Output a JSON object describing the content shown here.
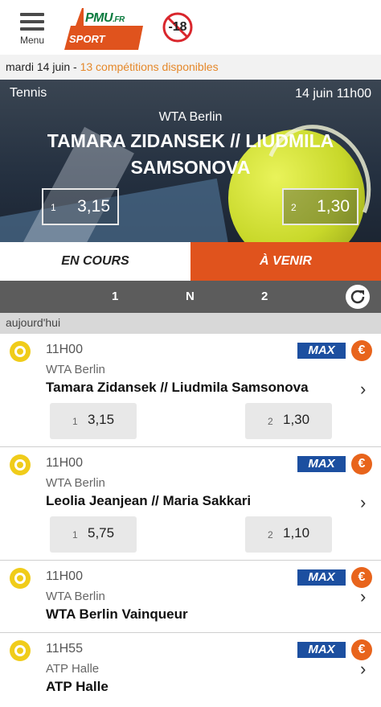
{
  "header": {
    "menu_label": "Menu",
    "logo_text": "PMU",
    "logo_suffix": ".FR",
    "logo_sport": "SPORT",
    "age_limit": "-18"
  },
  "dateline": {
    "date": "mardi 14 juin - ",
    "competitions": "13 compétitions disponibles"
  },
  "hero": {
    "sport": "Tennis",
    "datetime": "14 juin 11h00",
    "competition": "WTA Berlin",
    "match": "TAMARA ZIDANSEK // LIUDMILA SAMSONOVA",
    "odd1": {
      "index": "1",
      "value": "3,15"
    },
    "odd2": {
      "index": "2",
      "value": "1,30"
    }
  },
  "tabs": {
    "live": "EN COURS",
    "upcoming": "À VENIR"
  },
  "odds_header": {
    "c1": "1",
    "cn": "N",
    "c2": "2"
  },
  "section": "aujourd'hui",
  "events": [
    {
      "time": "11H00",
      "competition": "WTA Berlin",
      "name": "Tamara Zidansek // Liudmila Samsonova",
      "badge": "MAX",
      "euro": "€",
      "odd1": {
        "index": "1",
        "value": "3,15"
      },
      "odd2": {
        "index": "2",
        "value": "1,30"
      }
    },
    {
      "time": "11H00",
      "competition": "WTA Berlin",
      "name": "Leolia Jeanjean // Maria Sakkari",
      "badge": "MAX",
      "euro": "€",
      "odd1": {
        "index": "1",
        "value": "5,75"
      },
      "odd2": {
        "index": "2",
        "value": "1,10"
      }
    },
    {
      "time": "11H00",
      "competition": "WTA Berlin",
      "name": "WTA Berlin Vainqueur",
      "badge": "MAX",
      "euro": "€"
    },
    {
      "time": "11H55",
      "competition": "ATP Halle",
      "name": "ATP Halle",
      "badge": "MAX",
      "euro": "€"
    }
  ],
  "colors": {
    "accent": "#e0531d",
    "link": "#e5882a",
    "max_badge": "#1c4fa0",
    "brand_green": "#0b7a3e"
  }
}
